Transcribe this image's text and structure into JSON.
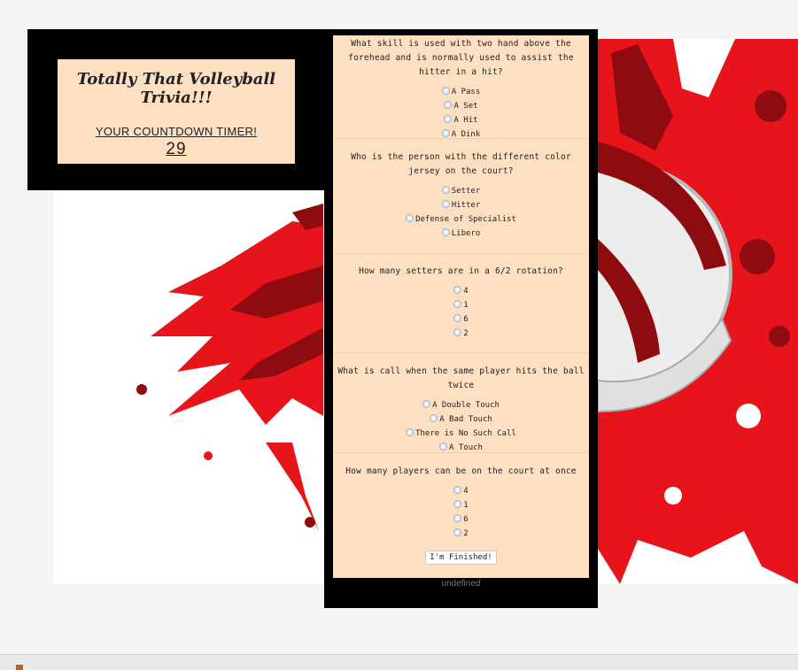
{
  "header": {
    "title": "Totally That Volleyball Trivia!!!",
    "timer_label": "YOUR COUNTDOWN TIMER!",
    "timer_value": "29"
  },
  "questions": [
    {
      "text": "What skill is used with two hand above the forehead and is normally used to assist the hitter in a hit?",
      "options": [
        "A Pass",
        "A Set",
        "A Hit",
        "A Dink"
      ]
    },
    {
      "text": "Who is the person with the different color jersey on the court?",
      "options": [
        "Setter",
        "Hitter",
        "Defense of Specialist",
        "Libero"
      ]
    },
    {
      "text": "How many setters are in a 6/2 rotation?",
      "options": [
        "4",
        "1",
        "6",
        "2"
      ]
    },
    {
      "text": "What is call when the same player hits the ball twice",
      "options": [
        "A Double Touch",
        "A Bad Touch",
        "There is No Such Call",
        "A Touch"
      ]
    },
    {
      "text": "How many players can be on the court at once",
      "options": [
        "4",
        "1",
        "6",
        "2"
      ]
    }
  ],
  "finish_button": "I'm Finished!",
  "result_text": "undefined",
  "colors": {
    "panel": "#000000",
    "card": "#fde0c2",
    "splash_red": "#e8141b",
    "splash_dark": "#8e0b10"
  }
}
